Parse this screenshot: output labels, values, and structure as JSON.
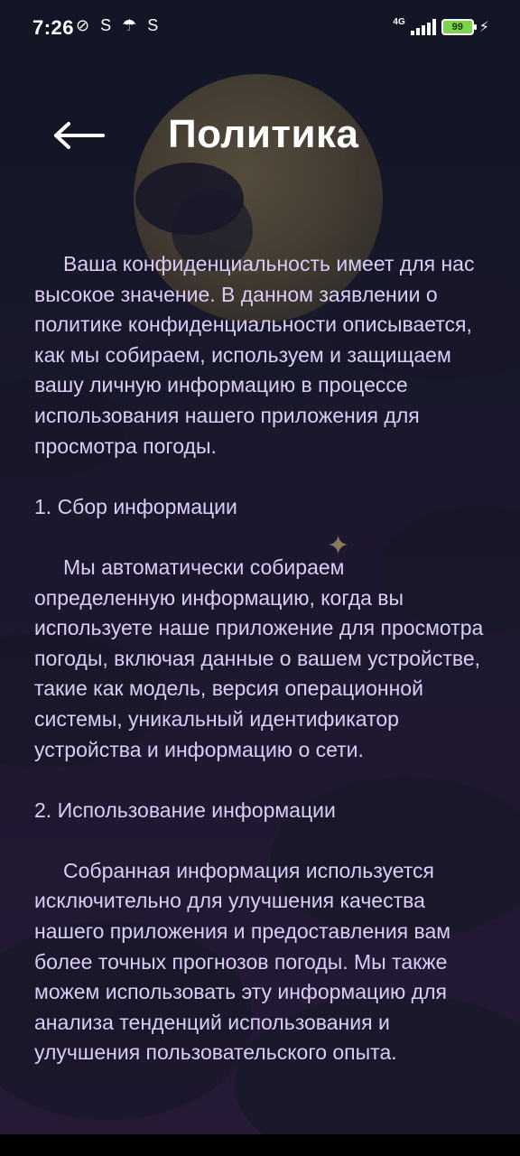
{
  "status_bar": {
    "time": "7:26",
    "network": "4G",
    "battery": "99"
  },
  "header": {
    "title": "Политика"
  },
  "policy": {
    "intro": "Ваша конфиденциальность имеет для нас высокое значение. В данном заявлении о политике конфиденциальности описывается, как мы собираем, используем и защищаем вашу личную информацию в процессе использования нашего приложения для просмотра погоды.",
    "section1_title": "1. Сбор информации",
    "section1_body": "Мы автоматически собираем определенную информацию, когда вы используете наше приложение для просмотра погоды, включая данные о вашем устройстве, такие как модель, версия операционной системы, уникальный идентификатор устройства и информацию о сети.",
    "section2_title": "2. Использование информации",
    "section2_body": "Собранная информация используется исключительно для улучшения качества нашего приложения и предоставления вам более точных прогнозов погоды. Мы также можем использовать эту информацию для анализа тенденций использования и улучшения пользовательского опыта."
  },
  "colors": {
    "text": "#d9ccf5",
    "title": "#ffffff",
    "battery_fill": "#7dd34a"
  },
  "icons": {
    "back": "arrow-left-icon"
  }
}
